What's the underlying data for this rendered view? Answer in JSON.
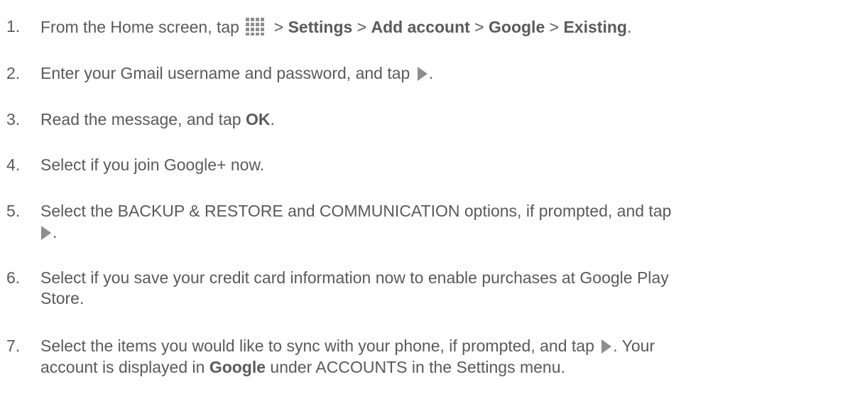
{
  "icons": {
    "apps_icon": "apps-grid-icon",
    "next_icon": "play-arrow-icon",
    "icon_color": "#8e8e8e"
  },
  "steps": [
    {
      "number": "1.",
      "parts": {
        "a": "From the Home screen, tap ",
        "b": " > ",
        "c": "Settings",
        "d": " > ",
        "e": "Add account",
        "f": " > ",
        "g": "Google",
        "h": " > ",
        "i": "Existing",
        "j": "."
      }
    },
    {
      "number": "2.",
      "parts": {
        "a": "Enter your Gmail username and password, and tap ",
        "b": "."
      }
    },
    {
      "number": "3.",
      "parts": {
        "a": "Read the message, and tap ",
        "b": "OK",
        "c": "."
      }
    },
    {
      "number": "4.",
      "parts": {
        "a": "Select if you join Google+ now."
      }
    },
    {
      "number": "5.",
      "parts": {
        "a": "Select the BACKUP & RESTORE and COMMUNICATION options, if prompted, and tap",
        "b": "."
      }
    },
    {
      "number": "6.",
      "parts": {
        "a": "Select if you save your credit card information now to enable purchases at Google Play",
        "b": "Store."
      }
    },
    {
      "number": "7.",
      "parts": {
        "a": "Select the items you would like to sync with your phone, if prompted, and tap ",
        "b": ". Your",
        "c": "account is displayed in ",
        "d": "Google",
        "e": " under ACCOUNTS in the Settings menu."
      }
    }
  ]
}
